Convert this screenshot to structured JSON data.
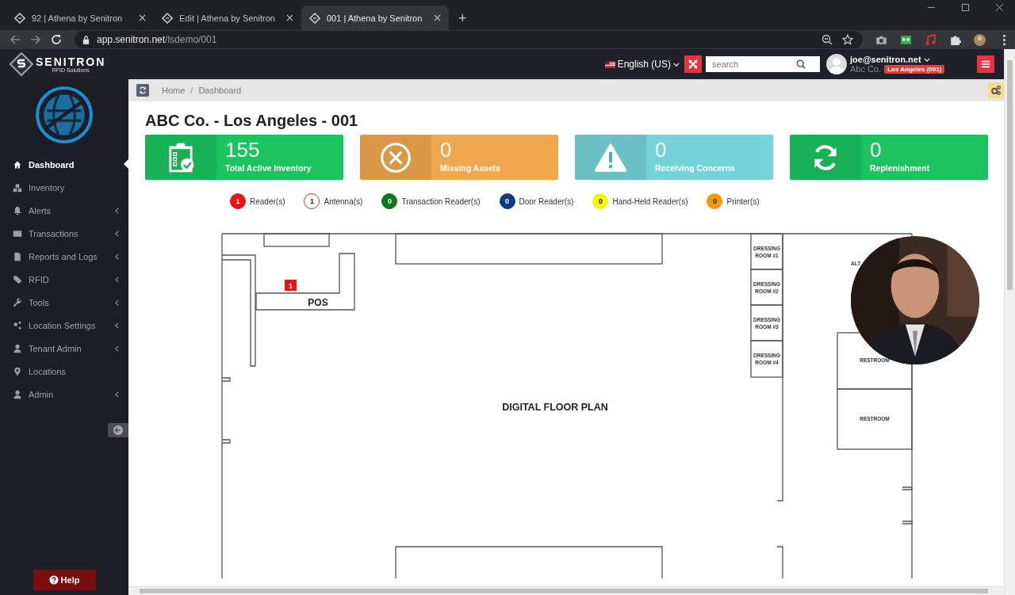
{
  "browser": {
    "tabs": [
      {
        "title": "92 | Athena by Senitron",
        "selected": false
      },
      {
        "title": "Edit | Athena by Senitron",
        "selected": false
      },
      {
        "title": "001 | Athena by Senitron",
        "selected": true
      }
    ],
    "new_tab": "+",
    "url_host": "app.senitron.net",
    "url_path": "/lsdemo/001"
  },
  "header": {
    "brand": "SENITRON",
    "tagline": "RFID Solutions",
    "language": "English (US)",
    "search": {
      "placeholder": "search"
    },
    "user": {
      "email": "joe@senitron.net",
      "company": "Abc Co.",
      "location": "Los Angeles (001)"
    }
  },
  "breadcrumb": [
    "Home",
    "Dashboard"
  ],
  "breadcrumb_separator": "/",
  "sidebar": {
    "items": [
      {
        "label": "Dashboard",
        "selected": true,
        "expandable": false
      },
      {
        "label": "Inventory",
        "selected": false,
        "expandable": false
      },
      {
        "label": "Alerts",
        "selected": false,
        "expandable": true
      },
      {
        "label": "Transactions",
        "selected": false,
        "expandable": true
      },
      {
        "label": "Reports and Logs",
        "selected": false,
        "expandable": true
      },
      {
        "label": "RFID",
        "selected": false,
        "expandable": true
      },
      {
        "label": "Tools",
        "selected": false,
        "expandable": true
      },
      {
        "label": "Location Settings",
        "selected": false,
        "expandable": true
      },
      {
        "label": "Tenant Admin",
        "selected": false,
        "expandable": true
      },
      {
        "label": "Locations",
        "selected": false,
        "expandable": false
      },
      {
        "label": "Admin",
        "selected": false,
        "expandable": true
      }
    ],
    "help": "Help"
  },
  "page_title": "ABC Co. - Los Angeles - 001",
  "cards": [
    {
      "value": "155",
      "label": "Total Active Inventory",
      "color": "#1cc35f"
    },
    {
      "value": "0",
      "label": "Missing Assets",
      "color": "#f0a84e"
    },
    {
      "value": "0",
      "label": "Receiving Concerns",
      "color": "#74d3d9"
    },
    {
      "value": "0",
      "label": "Replenishment",
      "color": "#1cc35f"
    }
  ],
  "legend": [
    {
      "count": "1",
      "label": "Reader(s)",
      "color": "#ee1111",
      "kind": "filled"
    },
    {
      "count": "1",
      "label": "Antenna(s)",
      "color": "#c0392b",
      "kind": "outline"
    },
    {
      "count": "0",
      "label": "Transaction Reader(s)",
      "color": "#0b7a1e",
      "kind": "filled"
    },
    {
      "count": "0",
      "label": "Door Reader(s)",
      "color": "#0c3a80",
      "kind": "filled"
    },
    {
      "count": "0",
      "label": "Hand-Held Reader(s)",
      "color": "#f5f50a",
      "kind": "filled"
    },
    {
      "count": "0",
      "label": "Printer(s)",
      "color": "#f39a0c",
      "kind": "filled"
    }
  ],
  "floor_plan": {
    "title": "DIGITAL FLOOR PLAN",
    "pos_label": "POS",
    "reader_marker": "1",
    "partial_label": "ALT",
    "dressing_rooms": [
      {
        "lines": [
          "DRESSING",
          "ROOM #1"
        ]
      },
      {
        "lines": [
          "DRESSING",
          "ROOM #2"
        ]
      },
      {
        "lines": [
          "DRESSING",
          "ROOM #3"
        ]
      },
      {
        "lines": [
          "DRESSING",
          "ROOM #4"
        ]
      }
    ],
    "restrooms": [
      "RESTROOM",
      "RESTROOM"
    ]
  },
  "webcam": {
    "kind": "picture"
  }
}
